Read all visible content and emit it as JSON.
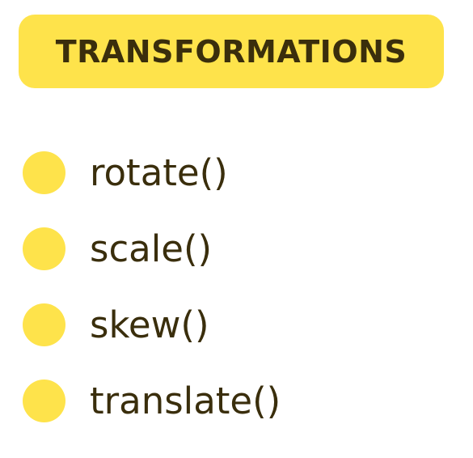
{
  "header": {
    "title": "TRANSFORMATIONS"
  },
  "colors": {
    "accent": "#FEE34B",
    "text": "#3A2E0C"
  },
  "list": {
    "items": [
      {
        "label": "rotate()"
      },
      {
        "label": "scale()"
      },
      {
        "label": "skew()"
      },
      {
        "label": "translate()"
      }
    ]
  }
}
